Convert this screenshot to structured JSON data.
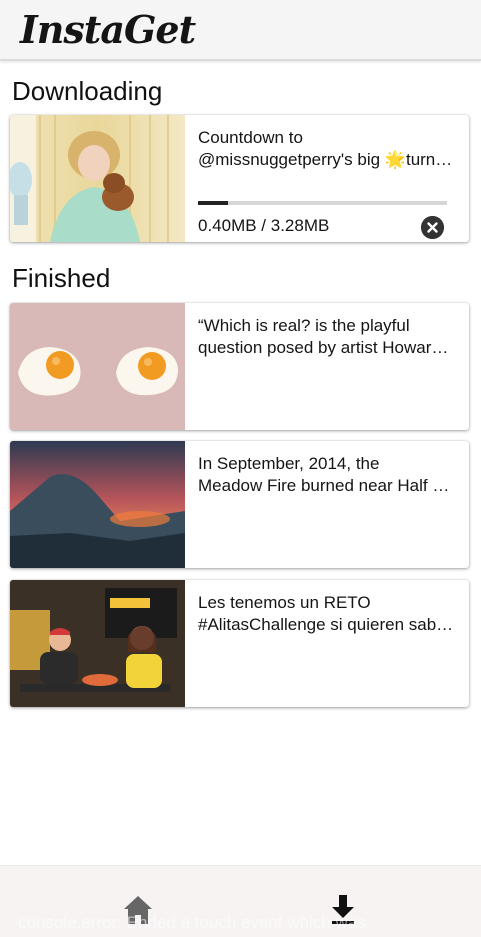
{
  "app": {
    "logo": "InstaGet"
  },
  "sections": {
    "downloading": "Downloading",
    "finished": "Finished"
  },
  "downloading": [
    {
      "caption_line1": "Countdown to",
      "caption_line2": "@missnuggetperry's big 🌟turning one!",
      "size_text": "0.40MB / 3.28MB",
      "progress": 0.12,
      "cancel_icon": "close-circle-icon"
    }
  ],
  "finished": [
    {
      "caption_line1": "“Which is real? is the playful",
      "caption_line2": "question posed by artist Howard Lee"
    },
    {
      "caption_line1": "In September, 2014, the",
      "caption_line2": "Meadow Fire burned near Half Dome"
    },
    {
      "caption_line1": "Les tenemos un RETO",
      "caption_line2": "#AlitasChallenge si quieren saber más"
    }
  ],
  "bottom_nav": {
    "home_icon": "home-icon",
    "downloads_icon": "download-icon"
  },
  "console_overlay": "console.error: Ended a touch event which was"
}
